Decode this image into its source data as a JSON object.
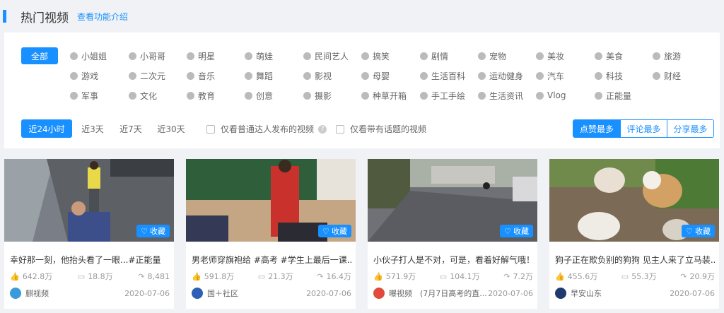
{
  "header": {
    "title": "热门视频",
    "intro_link": "查看功能介绍"
  },
  "categories": {
    "all_label": "全部",
    "items": [
      {
        "label": "小姐姐",
        "icon": "person-icon"
      },
      {
        "label": "小哥哥",
        "icon": "person-icon"
      },
      {
        "label": "明星",
        "icon": "star-icon"
      },
      {
        "label": "萌娃",
        "icon": "baby-icon"
      },
      {
        "label": "民间艺人",
        "icon": "artist-icon"
      },
      {
        "label": "搞笑",
        "icon": "smile-icon"
      },
      {
        "label": "剧情",
        "icon": "drama-icon"
      },
      {
        "label": "宠物",
        "icon": "pet-icon"
      },
      {
        "label": "美妆",
        "icon": "makeup-icon"
      },
      {
        "label": "美食",
        "icon": "food-icon"
      },
      {
        "label": "旅游",
        "icon": "travel-icon"
      },
      {
        "label": "游戏",
        "icon": "gamepad-icon"
      },
      {
        "label": "二次元",
        "icon": "anime-icon"
      },
      {
        "label": "音乐",
        "icon": "music-icon"
      },
      {
        "label": "舞蹈",
        "icon": "dance-icon"
      },
      {
        "label": "影视",
        "icon": "film-icon"
      },
      {
        "label": "母婴",
        "icon": "bottle-icon"
      },
      {
        "label": "生活百科",
        "icon": "book-icon"
      },
      {
        "label": "运动健身",
        "icon": "run-icon"
      },
      {
        "label": "汽车",
        "icon": "car-icon"
      },
      {
        "label": "科技",
        "icon": "tech-icon"
      },
      {
        "label": "财经",
        "icon": "finance-icon"
      },
      {
        "label": "军事",
        "icon": "military-icon"
      },
      {
        "label": "文化",
        "icon": "culture-icon"
      },
      {
        "label": "教育",
        "icon": "education-icon"
      },
      {
        "label": "创意",
        "icon": "idea-icon"
      },
      {
        "label": "摄影",
        "icon": "camera-icon"
      },
      {
        "label": "种草开箱",
        "icon": "box-icon"
      },
      {
        "label": "手工手绘",
        "icon": "paint-icon"
      },
      {
        "label": "生活资讯",
        "icon": "news-icon"
      },
      {
        "label": "Vlog",
        "icon": "vlog-icon"
      },
      {
        "label": "正能量",
        "icon": "positive-icon"
      }
    ]
  },
  "time_tabs": [
    "近24小时",
    "近3天",
    "近7天",
    "近30天"
  ],
  "filters": {
    "ordinary_only": "仅看普通达人发布的视频",
    "topic_only": "仅看带有话题的视频",
    "help_glyph": "?"
  },
  "sort": [
    "点赞最多",
    "评论最多",
    "分享最多"
  ],
  "fav_label": "收藏",
  "colors": {
    "accent": "#1890ff"
  },
  "videos": [
    {
      "title": "幸好那一刻，他抬头看了一眼...#正能量",
      "likes": "642.8万",
      "comments": "18.8万",
      "shares": "8,481",
      "author": "麒视频",
      "date": "2020-07-06",
      "avatar_color": "#3a9bdc"
    },
    {
      "title": "男老师穿旗袍给 #高考 #学生上最后一课...",
      "likes": "591.8万",
      "comments": "21.3万",
      "shares": "16.4万",
      "author": "国＋社区",
      "date": "2020-07-06",
      "avatar_color": "#2d5fb5"
    },
    {
      "title": "小伙子打人是不对，可是，看着好解气哦！",
      "likes": "571.9万",
      "comments": "104.1万",
      "shares": "7.2万",
      "author": "曝视频　(7月7日高考的直...",
      "date": "2020-07-06",
      "avatar_color": "#e04a3a"
    },
    {
      "title": "狗子正在欺负别的狗狗 见主人来了立马装...",
      "likes": "455.6万",
      "comments": "55.3万",
      "shares": "20.9万",
      "author": "早安山东",
      "date": "2020-07-06",
      "avatar_color": "#1f3a6e"
    }
  ]
}
